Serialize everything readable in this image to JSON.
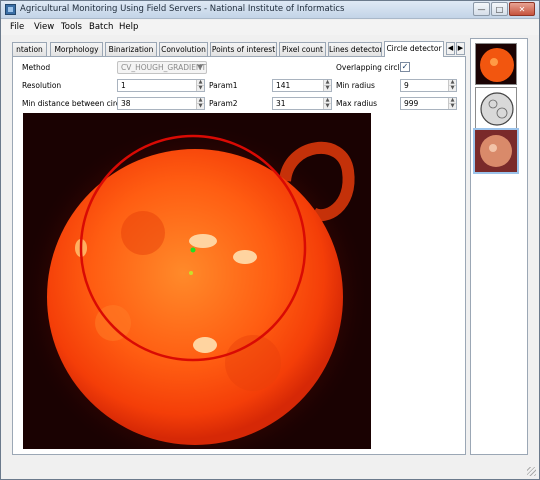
{
  "window": {
    "title": "Agricultural Monitoring Using Field Servers - National Institute of Informatics",
    "controls": {
      "minimize": "—",
      "maximize": "□",
      "close": "✕"
    }
  },
  "menu": [
    "File",
    "View",
    "Tools",
    "Batch",
    "Help"
  ],
  "tabs": [
    {
      "label": "ntation",
      "active": false
    },
    {
      "label": "Morphology",
      "active": false
    },
    {
      "label": "Binarization",
      "active": false
    },
    {
      "label": "Convolution",
      "active": false
    },
    {
      "label": "Points of interest",
      "active": false
    },
    {
      "label": "Pixel count",
      "active": false
    },
    {
      "label": "Lines detector",
      "active": false
    },
    {
      "label": "Circle detector",
      "active": true
    }
  ],
  "tab_scroll": {
    "left": "◀",
    "right": "▶"
  },
  "form": {
    "method_label": "Method",
    "method_value": "CV_HOUGH_GRADIENT",
    "overlapping_label": "Overlapping circles",
    "overlapping_checked": true,
    "resolution_label": "Resolution",
    "resolution_value": "1",
    "param1_label": "Param1",
    "param1_value": "141",
    "min_radius_label": "Min radius",
    "min_radius_value": "9",
    "min_distance_label": "Min distance between circles",
    "min_distance_value": "38",
    "param2_label": "Param2",
    "param2_value": "31",
    "max_radius_label": "Max radius",
    "max_radius_value": "999",
    "spin_up": "▲",
    "spin_down": "▼",
    "combo_arrow": "▼",
    "check_mark": "✓"
  },
  "thumbnails": [
    {
      "name": "sun-orange",
      "selected": false
    },
    {
      "name": "sun-sketch-grayscale",
      "selected": false
    },
    {
      "name": "sun-pink",
      "selected": true
    }
  ]
}
